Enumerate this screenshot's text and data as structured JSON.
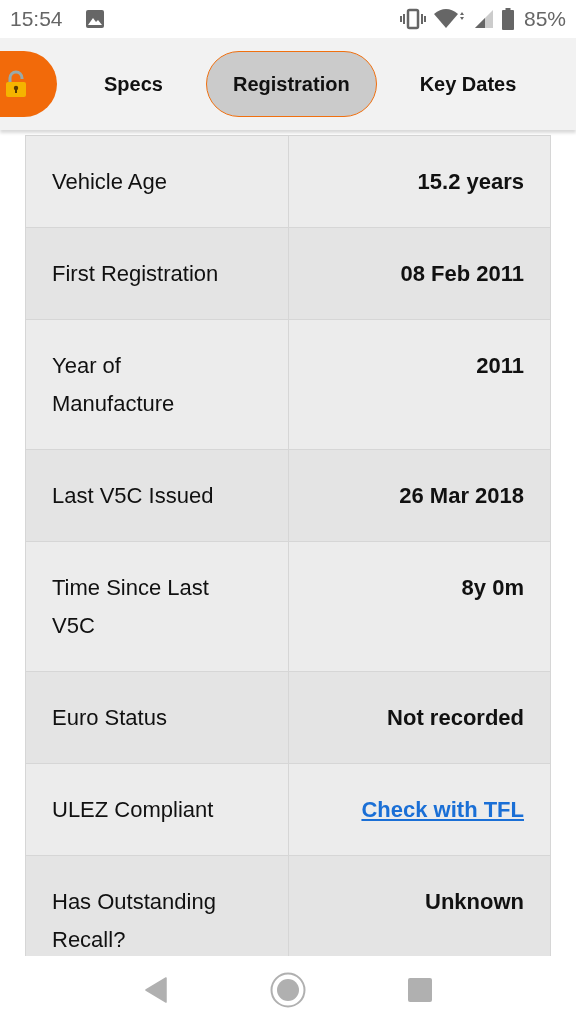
{
  "status_bar": {
    "time": "15:54",
    "battery": "85%"
  },
  "tabs": [
    {
      "label": "Specs",
      "selected": false
    },
    {
      "label": "Registration",
      "selected": true
    },
    {
      "label": "Key Dates",
      "selected": false
    }
  ],
  "rows": [
    {
      "label": "Vehicle Age",
      "value": "15.2 years",
      "kind": "text"
    },
    {
      "label": "First Registration",
      "value": "08 Feb 2011",
      "kind": "text"
    },
    {
      "label": "Year of Manufacture",
      "value": "2011",
      "kind": "text"
    },
    {
      "label": "Last V5C Issued",
      "value": "26 Mar 2018",
      "kind": "text"
    },
    {
      "label": "Time Since Last V5C",
      "value": "8y 0m",
      "kind": "text"
    },
    {
      "label": "Euro Status",
      "value": "Not recorded",
      "kind": "text"
    },
    {
      "label": "ULEZ Compliant",
      "value": "Check with TFL",
      "kind": "link"
    },
    {
      "label": "Has Outstanding Recall?",
      "value": "Unknown",
      "kind": "text"
    }
  ]
}
